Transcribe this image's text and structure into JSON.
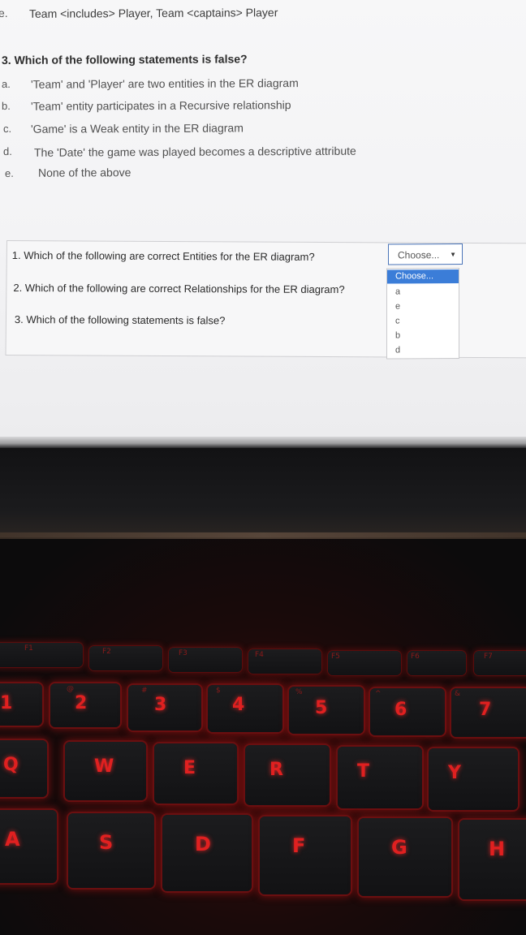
{
  "screen": {
    "prev_option": {
      "letter": "e.",
      "text": "Team <includes> Player, Team <captains> Player"
    },
    "question3": {
      "title": "3. Which of the following statements is false?",
      "options": [
        {
          "letter": "a.",
          "text": "'Team' and 'Player' are two entities in the ER diagram"
        },
        {
          "letter": "b.",
          "text": "'Team' entity participates in a Recursive relationship"
        },
        {
          "letter": "c.",
          "text": "'Game' is a Weak entity in the ER diagram"
        },
        {
          "letter": "d.",
          "text": "The 'Date' the game was played becomes a descriptive attribute"
        },
        {
          "letter": "e.",
          "text": "None of the above"
        }
      ]
    },
    "summary": {
      "q1": "1. Which of the following are correct Entities for the ER diagram?",
      "q2": "2. Which of the following are correct Relationships for the ER diagram?",
      "q3": "3. Which of the following statements is false?"
    },
    "select": {
      "value": "Choose...",
      "options": [
        "Choose...",
        "a",
        "e",
        "c",
        "b",
        "d"
      ]
    }
  },
  "keyboard": {
    "fn_row": [
      "F1",
      "F2",
      "F3",
      "F4",
      "F5",
      "F6",
      "F7"
    ],
    "num_row": [
      "1",
      "2",
      "3",
      "4",
      "5",
      "6",
      "7"
    ],
    "num_row_symbols": [
      "@",
      "#",
      "$",
      "%",
      "^",
      "&"
    ],
    "top_row": [
      "Q",
      "W",
      "E",
      "R",
      "T",
      "Y"
    ],
    "home_row": [
      "A",
      "S",
      "D",
      "F",
      "G",
      "H"
    ],
    "accent_color": "#e02020"
  }
}
